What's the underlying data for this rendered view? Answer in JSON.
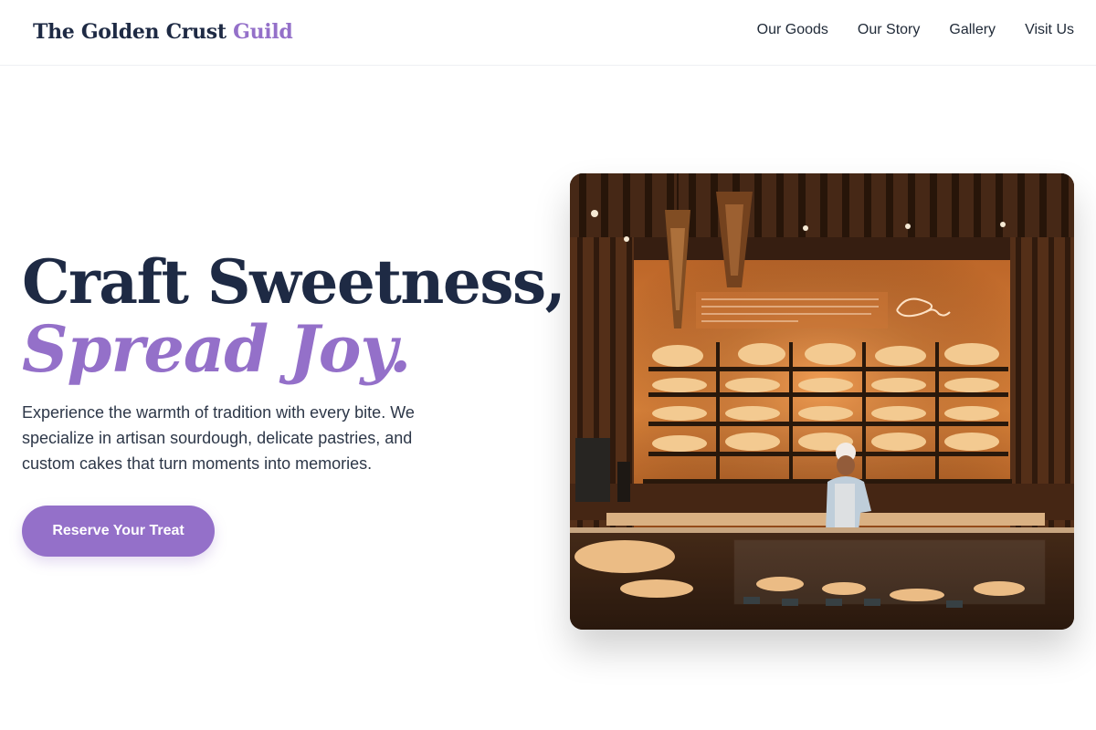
{
  "header": {
    "logo_main": "The Golden Crust",
    "logo_accent": "Guild",
    "nav": [
      {
        "label": "Our Goods"
      },
      {
        "label": "Our Story"
      },
      {
        "label": "Gallery"
      },
      {
        "label": "Visit Us"
      }
    ]
  },
  "hero": {
    "headline_line1": "Craft Sweetness,",
    "headline_line2": "Spread Joy.",
    "description": "Experience the warmth of tradition with every bite. We specialize in artisan sourdough, delicate pastries, and custom cakes that turn moments into memories.",
    "cta_label": "Reserve Your Treat",
    "image_alt": "Bakery counter with shelves of bread and a baker behind a glass display case"
  },
  "colors": {
    "accent": "#9470c9",
    "heading": "#1e2a44",
    "text": "#2d3748"
  }
}
